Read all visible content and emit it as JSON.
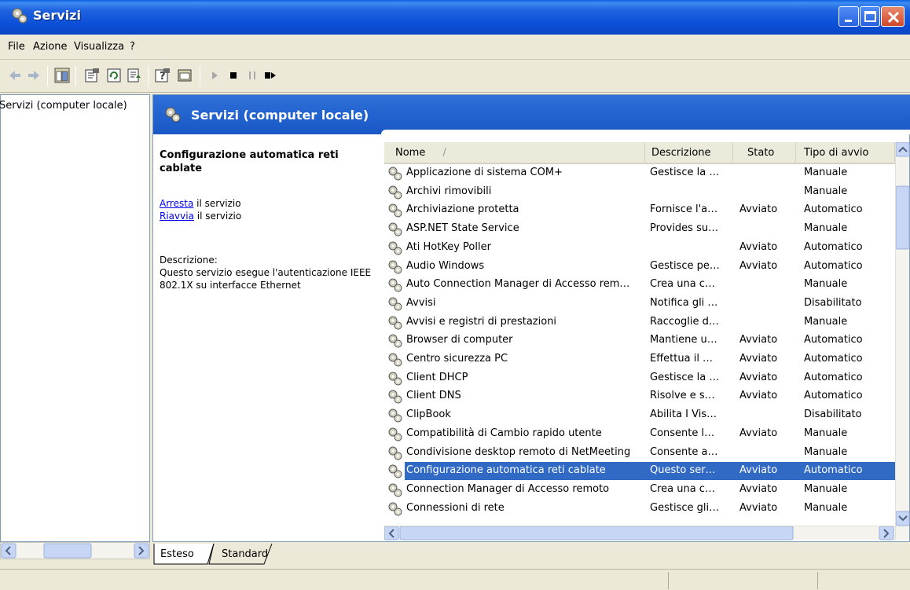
{
  "window": {
    "title": "Servizi"
  },
  "menu": [
    "File",
    "Azione",
    "Visualizza",
    "?"
  ],
  "tree": {
    "root": "Servizi (computer locale)"
  },
  "header": {
    "title": "Servizi (computer locale)"
  },
  "details": {
    "service_title": "Configurazione automatica reti cablate",
    "stop_link": "Arresta",
    "stop_rest": " il servizio",
    "restart_link": "Riavvia",
    "restart_rest": " il servizio",
    "description_label": "Descrizione:",
    "description_text": "Questo servizio esegue l'autenticazione IEEE 802.1X su interfacce Ethernet"
  },
  "columns": [
    "Nome",
    "Descrizione",
    "Stato",
    "Tipo di avvio"
  ],
  "sort_indicator": "/",
  "rows": [
    {
      "name": "Applicazione di sistema COM+",
      "desc": "Gestisce la …",
      "status": "",
      "startup": "Manuale"
    },
    {
      "name": "Archivi rimovibili",
      "desc": "",
      "status": "",
      "startup": "Manuale"
    },
    {
      "name": "Archiviazione protetta",
      "desc": "Fornisce l'a…",
      "status": "Avviato",
      "startup": "Automatico"
    },
    {
      "name": "ASP.NET State Service",
      "desc": "Provides su…",
      "status": "",
      "startup": "Manuale"
    },
    {
      "name": "Ati HotKey Poller",
      "desc": "",
      "status": "Avviato",
      "startup": "Automatico"
    },
    {
      "name": "Audio Windows",
      "desc": "Gestisce pe…",
      "status": "Avviato",
      "startup": "Automatico"
    },
    {
      "name": "Auto Connection Manager di Accesso rem…",
      "desc": "Crea una c…",
      "status": "",
      "startup": "Manuale"
    },
    {
      "name": "Avvisi",
      "desc": "Notifica gli …",
      "status": "",
      "startup": "Disabilitato"
    },
    {
      "name": "Avvisi e registri di prestazioni",
      "desc": "Raccoglie d…",
      "status": "",
      "startup": "Manuale"
    },
    {
      "name": "Browser di computer",
      "desc": "Mantiene u…",
      "status": "Avviato",
      "startup": "Automatico"
    },
    {
      "name": "Centro sicurezza PC",
      "desc": "Effettua il …",
      "status": "Avviato",
      "startup": "Automatico"
    },
    {
      "name": "Client DHCP",
      "desc": "Gestisce la …",
      "status": "Avviato",
      "startup": "Automatico"
    },
    {
      "name": "Client DNS",
      "desc": "Risolve e s…",
      "status": "Avviato",
      "startup": "Automatico"
    },
    {
      "name": "ClipBook",
      "desc": "Abilita I Vis…",
      "status": "",
      "startup": "Disabilitato"
    },
    {
      "name": "Compatibilità di Cambio rapido utente",
      "desc": "Consente l…",
      "status": "Avviato",
      "startup": "Manuale"
    },
    {
      "name": "Condivisione desktop remoto di NetMeeting",
      "desc": "Consente a…",
      "status": "",
      "startup": "Manuale"
    },
    {
      "name": "Configurazione automatica reti cablate",
      "desc": "Questo ser…",
      "status": "Avviato",
      "startup": "Automatico",
      "selected": true
    },
    {
      "name": "Connection Manager di Accesso remoto",
      "desc": "Crea una c…",
      "status": "Avviato",
      "startup": "Manuale"
    },
    {
      "name": "Connessioni di rete",
      "desc": "Gestisce gli…",
      "status": "Avviato",
      "startup": "Manuale"
    }
  ],
  "tabs": [
    "Esteso",
    "Standard"
  ],
  "colors": {
    "selection": "#316AC5",
    "title_bar": "#0B4FD8",
    "link": "#0000EE"
  },
  "icons": [
    "services-icon",
    "back-arrow-icon",
    "forward-arrow-icon",
    "show-hide-tree-icon",
    "properties-icon",
    "refresh-icon",
    "export-list-icon",
    "help-icon",
    "console-icon",
    "play-icon",
    "stop-icon",
    "pause-icon",
    "restart-icon",
    "gear-icon"
  ]
}
